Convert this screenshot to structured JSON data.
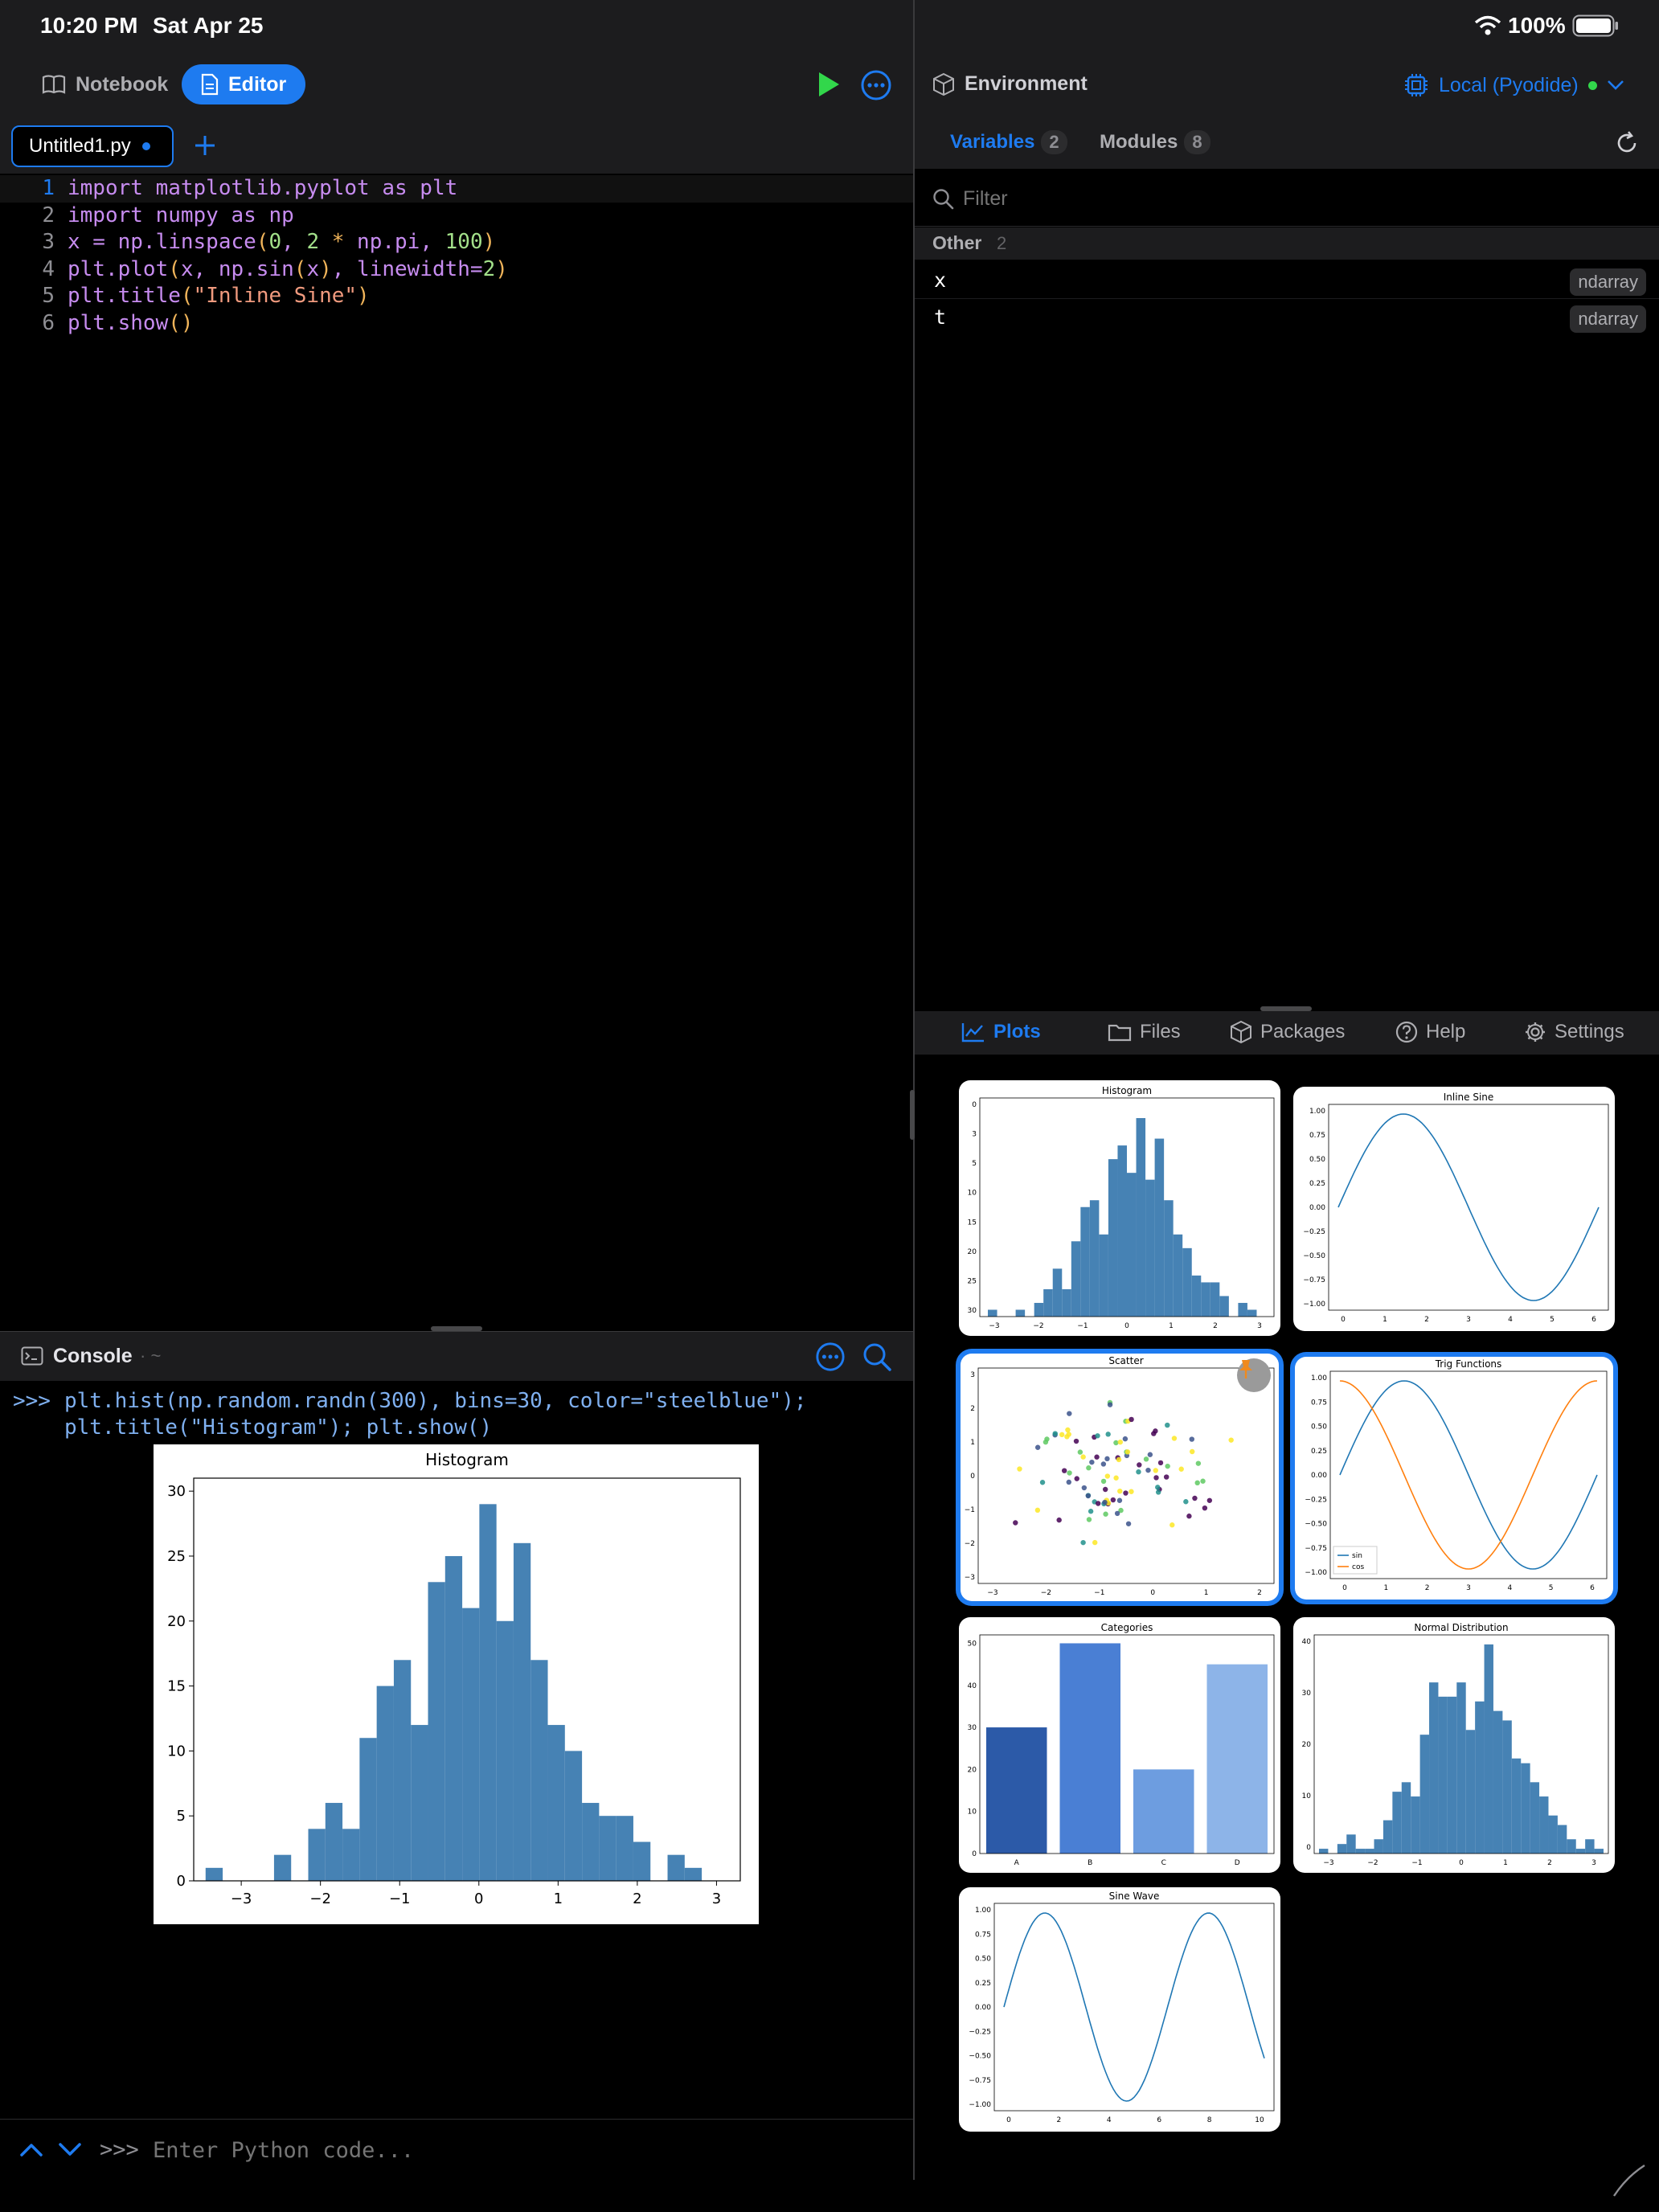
{
  "status": {
    "time": "10:20 PM",
    "date": "Sat Apr 25",
    "battery": "100%"
  },
  "toolbar": {
    "notebook_label": "Notebook",
    "editor_label": "Editor"
  },
  "editor": {
    "tab_title": "Untitled1.py",
    "lines": [
      {
        "n": "1",
        "code": "import matplotlib.pyplot as plt"
      },
      {
        "n": "2",
        "code": "import numpy as np"
      },
      {
        "n": "3",
        "code": "x = np.linspace(0, 2 * np.pi, 100)"
      },
      {
        "n": "4",
        "code": "plt.plot(x, np.sin(x), linewidth=2)"
      },
      {
        "n": "5",
        "code": "plt.title(\"Inline Sine\")"
      },
      {
        "n": "6",
        "code": "plt.show()"
      }
    ]
  },
  "console": {
    "title": "Console",
    "path": "· ~",
    "prompt": ">>>",
    "command_line1": "plt.hist(np.random.randn(300), bins=30, color=\"steelblue\");",
    "command_line2": "plt.title(\"Histogram\"); plt.show()",
    "input_prompt": ">>>",
    "input_placeholder": "Enter Python code..."
  },
  "environment": {
    "title": "Environment",
    "runtime": "Local (Pyodide)",
    "tabs": [
      {
        "label": "Variables",
        "count": "2"
      },
      {
        "label": "Modules",
        "count": "8"
      }
    ],
    "filter_placeholder": "Filter",
    "group": {
      "label": "Other",
      "count": "2"
    },
    "variables": [
      {
        "name": "x",
        "type": "ndarray"
      },
      {
        "name": "t",
        "type": "ndarray"
      }
    ]
  },
  "bottom_tabs": [
    "Plots",
    "Files",
    "Packages",
    "Help",
    "Settings"
  ],
  "colors": {
    "accent": "#1e7bf0",
    "steelblue": "#4682b4",
    "orange": "#ff7f0e",
    "run": "#32d74b"
  },
  "chart_data": [
    {
      "id": "console-histogram",
      "type": "bar",
      "title": "Histogram",
      "xlim": [
        -3.6,
        3.3
      ],
      "ylim": [
        0,
        31
      ],
      "xticks": [
        "-3",
        "-2",
        "-1",
        "0",
        "1",
        "2",
        "3"
      ],
      "yticks": [
        "0",
        "5",
        "10",
        "15",
        "20",
        "25",
        "30"
      ],
      "bin_start": -3.45,
      "bin_width": 0.216,
      "values": [
        1,
        0,
        0,
        0,
        2,
        0,
        4,
        6,
        4,
        11,
        15,
        17,
        12,
        23,
        25,
        21,
        29,
        20,
        26,
        17,
        12,
        10,
        6,
        5,
        5,
        3,
        0,
        2,
        1,
        0
      ]
    },
    {
      "id": "thumb-histogram",
      "type": "bar",
      "title": "Histogram",
      "yticks": [
        "0",
        "3",
        "5",
        "10",
        "15",
        "20",
        "25",
        "30"
      ],
      "xticks": [
        "-3",
        "-2",
        "-1",
        "0",
        "1",
        "2",
        "3"
      ]
    },
    {
      "id": "thumb-inline-sine",
      "type": "line",
      "title": "Inline Sine",
      "yticks": [
        "1.00",
        "0.75",
        "0.50",
        "0.25",
        "0.00",
        "-0.25",
        "-0.50",
        "-0.75",
        "-1.00"
      ],
      "xticks": [
        "0",
        "1",
        "2",
        "3",
        "4",
        "5",
        "6"
      ]
    },
    {
      "id": "thumb-scatter",
      "type": "scatter",
      "title": "Scatter",
      "yticks": [
        "3",
        "2",
        "1",
        "0",
        "-1",
        "-2",
        "-3"
      ],
      "xticks": [
        "-3",
        "-2",
        "-1",
        "0",
        "1",
        "2"
      ]
    },
    {
      "id": "thumb-trig",
      "type": "line",
      "title": "Trig Functions",
      "series": [
        {
          "name": "sin"
        },
        {
          "name": "cos"
        }
      ],
      "yticks": [
        "1.00",
        "0.75",
        "0.50",
        "0.25",
        "0.00",
        "-0.25",
        "-0.50",
        "-0.75",
        "-1.00"
      ],
      "xticks": [
        "0",
        "1",
        "2",
        "3",
        "4",
        "5",
        "6"
      ]
    },
    {
      "id": "thumb-categories",
      "type": "bar",
      "title": "Categories",
      "categories": [
        "A",
        "B",
        "C",
        "D"
      ],
      "values": [
        30,
        50,
        20,
        45
      ],
      "yticks": [
        "0",
        "10",
        "20",
        "30",
        "40",
        "50"
      ]
    },
    {
      "id": "thumb-normal",
      "type": "bar",
      "title": "Normal Distribution",
      "yticks": [
        "0",
        "10",
        "20",
        "30",
        "40"
      ],
      "xticks": [
        "-3",
        "-2",
        "-1",
        "0",
        "1",
        "2",
        "3"
      ]
    },
    {
      "id": "thumb-sine-wave",
      "type": "line",
      "title": "Sine Wave",
      "yticks": [
        "1.00",
        "0.75",
        "0.50",
        "0.25",
        "0.00",
        "-0.25",
        "-0.50",
        "-0.75",
        "-1.00"
      ],
      "xticks": [
        "0",
        "2",
        "4",
        "6",
        "8",
        "10"
      ]
    }
  ]
}
